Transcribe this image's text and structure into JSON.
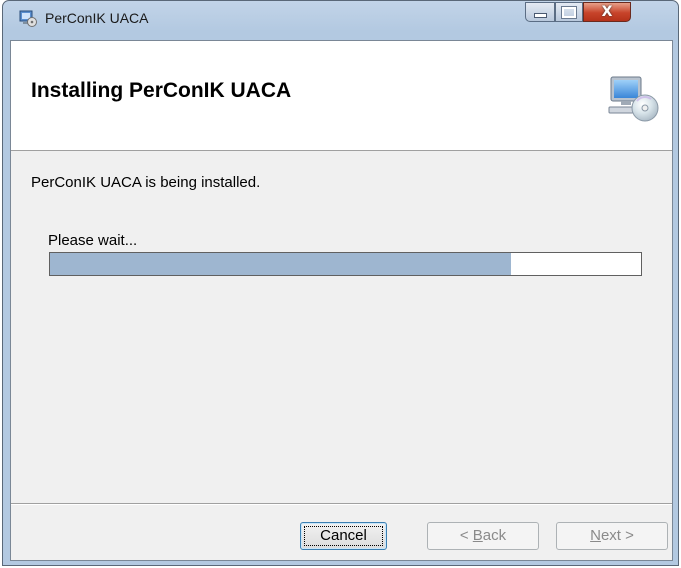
{
  "window": {
    "title": "PerConIK UACA",
    "controls": {
      "minimize": "minimize",
      "maximize": "maximize",
      "close": "X"
    }
  },
  "banner": {
    "title": "Installing PerConIK UACA",
    "icon": "computer-cd-icon"
  },
  "body": {
    "status_text": "PerConIK UACA is being installed.",
    "wait_label": "Please wait..."
  },
  "progress": {
    "percent": 78
  },
  "buttons": {
    "cancel": "Cancel",
    "back_prefix": "< ",
    "back_mnemonic": "B",
    "back_rest": "ack",
    "next_mnemonic": "N",
    "next_rest": "ext >"
  },
  "colors": {
    "progress_fill": "#9eb6d0",
    "close_button": "#c7432a"
  }
}
